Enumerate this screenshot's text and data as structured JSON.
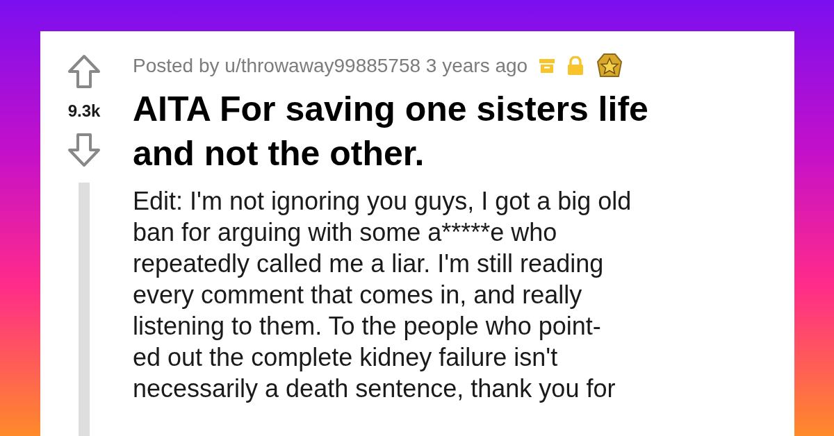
{
  "post": {
    "votes": "9.3k",
    "meta": "Posted by u/throwaway99885758 3 years ago",
    "title": "AITA For saving one sisters life and not the other.",
    "body_lines": [
      "Edit: I'm not ignoring you guys, I got a big old",
      "ban for arguing with some a*****e who",
      "repeatedly called me a liar. I'm still reading",
      "every comment that comes in, and really",
      "listening to them. To the people who point-",
      "ed out the complete kidney failure isn't",
      "necessarily a death sentence, thank you for"
    ]
  }
}
